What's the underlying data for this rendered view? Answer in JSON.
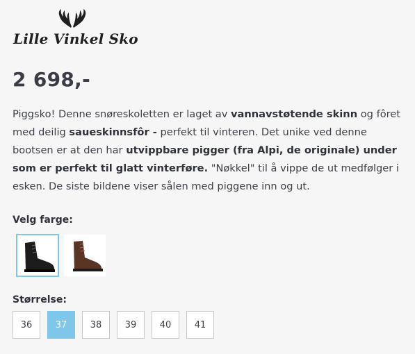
{
  "brand": {
    "name": "Lille Vinkel Sko",
    "logo_icon": "antlers-icon"
  },
  "product": {
    "price": "2 698,-",
    "description": [
      {
        "text": "Piggsko! Denne snøreskoletten er laget av ",
        "bold": false
      },
      {
        "text": "vannavstøtende skinn",
        "bold": true
      },
      {
        "text": " og fôret med deilig ",
        "bold": false
      },
      {
        "text": "saueskinnsfôr -",
        "bold": true
      },
      {
        "text": " perfekt til vinteren. Det unike ved denne bootsen er at den har ",
        "bold": false
      },
      {
        "text": "utvippbare pigger (fra Alpi, de originale) under som er perfekt til glatt vinterføre.",
        "bold": true
      },
      {
        "text": " \"Nøkkel\" til å vippe de ut medfølger i esken. De siste bildene viser sålen med piggene inn og ut.",
        "bold": false
      }
    ]
  },
  "color_picker": {
    "label": "Velg farge:",
    "options": [
      {
        "name": "black-boot",
        "color": "#1c1c1c",
        "selected": true
      },
      {
        "name": "brown-boot",
        "color": "#5a3424",
        "selected": false
      }
    ]
  },
  "size_picker": {
    "label": "Størrelse:",
    "options": [
      {
        "label": "36",
        "selected": false
      },
      {
        "label": "37",
        "selected": true
      },
      {
        "label": "38",
        "selected": false
      },
      {
        "label": "39",
        "selected": false
      },
      {
        "label": "40",
        "selected": false
      },
      {
        "label": "41",
        "selected": false
      }
    ]
  },
  "colors": {
    "accent": "#7ec7ea",
    "text": "#3a3d45",
    "background": "#f6f6f6"
  }
}
